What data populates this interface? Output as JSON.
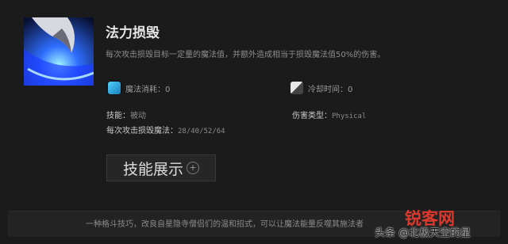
{
  "ability": {
    "name": "法力损毁",
    "description": "每次攻击损毁目标一定量的魔法值，并额外造成相当于损毁魔法值50%的伤害。",
    "icon": "mana-break-ability-icon"
  },
  "stats": {
    "mana_cost": "魔法消耗：0",
    "cooldown": "冷却时间：0"
  },
  "details": {
    "skill_label": "技能：",
    "skill_value": "被动",
    "damage_type_label": "伤害类型：",
    "damage_type_value": "Physical",
    "mana_burn_label": "每次攻击损毁魔法：",
    "mana_burn_value": "28/40/52/64"
  },
  "demo_button": {
    "label": "技能展示"
  },
  "lore": "一种格斗技巧，改良自星隐寺僧侣们的温和招式，可以让魔法能量反噬其施法者",
  "watermarks": {
    "site": "锐客网",
    "author": "头条 @北极天空的星"
  },
  "colors": {
    "background": "#1b1b1b",
    "mana_blue": "#4fd1ff",
    "watermark_red": "#e63a2e"
  }
}
